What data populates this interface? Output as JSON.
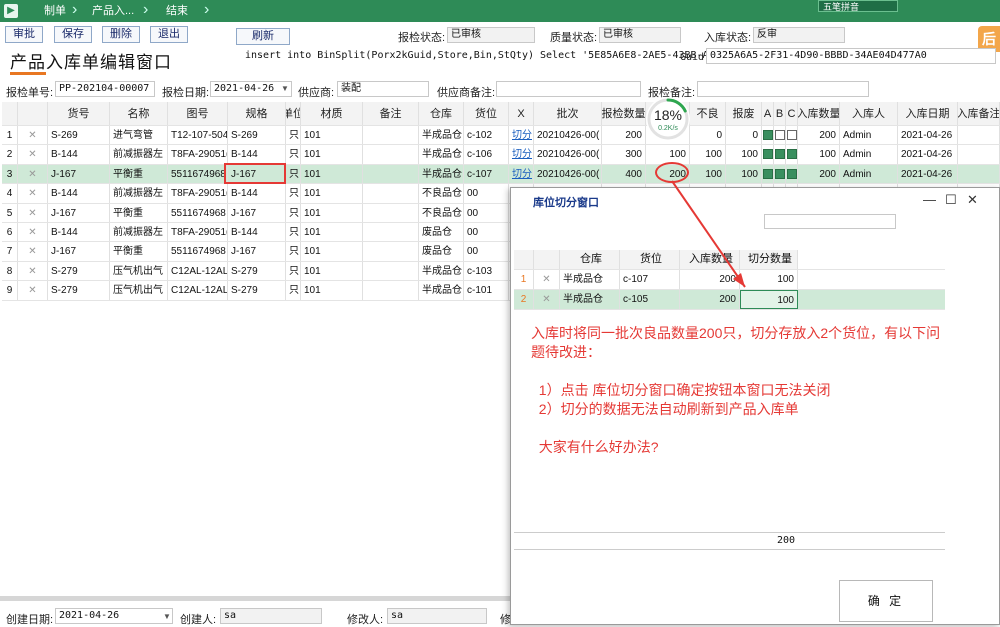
{
  "topbar": {
    "breadcrumb": [
      "制单",
      "产品入...",
      "结束"
    ],
    "ime_label": "五笔拼音"
  },
  "toolbar": {
    "buttons": [
      "审批",
      "保存",
      "删除",
      "退出"
    ],
    "refresh": "刷新",
    "inspect_status_label": "报检状态:",
    "inspect_status": "已审核",
    "quality_status_label": "质量状态:",
    "quality_status": "已审核",
    "stock_status_label": "入库状态:",
    "stock_status": "反审",
    "sql": "insert into  BinSplit(Porx2kGuid,Store,Bin,StQty)   Select '5E85A6E8-2AE5-43BB-AA8",
    "guid_label": "Guid:",
    "guid": "0325A6A5-2F31-4D90-BBBD-34AE04D477A0",
    "corner": "后"
  },
  "page_title": "产品入库单编辑窗口",
  "form": {
    "doc_no_label": "报检单号:",
    "doc_no": "PP-202104-00007",
    "date_label": "报检日期:",
    "date": "2021-04-26",
    "supplier_label": "供应商:",
    "supplier": "装配",
    "supplier_note_label": "供应商备注:",
    "inspect_note_label": "报检备注:"
  },
  "grid": {
    "headers": [
      "货号",
      "名称",
      "图号",
      "规格",
      "单位",
      "材质",
      "备注",
      "仓库",
      "货位",
      "X",
      "批次",
      "报检数量",
      "",
      "不良",
      "报废",
      "A",
      "B",
      "C",
      "入库数量",
      "入库人",
      "入库日期",
      "入库备注"
    ],
    "progress": {
      "percent": "18%",
      "speed": "0.2K/s",
      "fraction": 0.18
    },
    "rows": [
      {
        "no": "1",
        "code": "S-269",
        "name": "进气弯管",
        "drawing": "T12-107-504",
        "spec": "S-269",
        "unit": "只",
        "material": "101",
        "note": "",
        "warehouse": "半成品仓",
        "bin": "c-102",
        "split": "切分",
        "batch": "20210426-00(",
        "qty": "200",
        "good": "",
        "bad": "0",
        "scrap": "0",
        "a": true,
        "b": false,
        "c": false,
        "in_qty": "200",
        "user": "Admin",
        "in_date": "2021-04-26"
      },
      {
        "no": "2",
        "code": "B-144",
        "name": "前减振器左",
        "drawing": "T8FA-29051(",
        "spec": "B-144",
        "unit": "只",
        "material": "101",
        "note": "",
        "warehouse": "半成品仓",
        "bin": "c-106",
        "split": "切分",
        "batch": "20210426-00(",
        "qty": "300",
        "good": "100",
        "bad": "100",
        "scrap": "100",
        "a": true,
        "b": true,
        "c": true,
        "in_qty": "100",
        "user": "Admin",
        "in_date": "2021-04-26"
      },
      {
        "no": "3",
        "code": "J-167",
        "name": "平衡重",
        "drawing": "5511674968",
        "spec": "J-167",
        "unit": "只",
        "material": "101",
        "note": "",
        "warehouse": "半成品仓",
        "bin": "c-107",
        "split": "切分",
        "batch": "20210426-00(",
        "qty": "400",
        "good": "200",
        "bad": "100",
        "scrap": "100",
        "a": true,
        "b": true,
        "c": true,
        "in_qty": "200",
        "user": "Admin",
        "in_date": "2021-04-26"
      },
      {
        "no": "4",
        "code": "B-144",
        "name": "前减振器左",
        "drawing": "T8FA-29051(",
        "spec": "B-144",
        "unit": "只",
        "material": "101",
        "note": "",
        "warehouse": "不良品仓",
        "bin": "00",
        "split": "",
        "batch": "",
        "qty": "",
        "good": "",
        "bad": "",
        "scrap": "",
        "a": null,
        "b": null,
        "c": null,
        "in_qty": "",
        "user": "",
        "in_date": ""
      },
      {
        "no": "5",
        "code": "J-167",
        "name": "平衡重",
        "drawing": "5511674968",
        "spec": "J-167",
        "unit": "只",
        "material": "101",
        "note": "",
        "warehouse": "不良品仓",
        "bin": "00",
        "split": "",
        "batch": "",
        "qty": "",
        "good": "",
        "bad": "",
        "scrap": "",
        "a": null,
        "b": null,
        "c": null,
        "in_qty": "",
        "user": "",
        "in_date": ""
      },
      {
        "no": "6",
        "code": "B-144",
        "name": "前减振器左",
        "drawing": "T8FA-29051(",
        "spec": "B-144",
        "unit": "只",
        "material": "101",
        "note": "",
        "warehouse": "废品仓",
        "bin": "00",
        "split": "",
        "batch": "",
        "qty": "",
        "good": "",
        "bad": "",
        "scrap": "",
        "a": null,
        "b": null,
        "c": null,
        "in_qty": "",
        "user": "",
        "in_date": ""
      },
      {
        "no": "7",
        "code": "J-167",
        "name": "平衡重",
        "drawing": "5511674968",
        "spec": "J-167",
        "unit": "只",
        "material": "101",
        "note": "",
        "warehouse": "废品仓",
        "bin": "00",
        "split": "",
        "batch": "",
        "qty": "",
        "good": "",
        "bad": "",
        "scrap": "",
        "a": null,
        "b": null,
        "c": null,
        "in_qty": "",
        "user": "",
        "in_date": ""
      },
      {
        "no": "8",
        "code": "S-279",
        "name": "压气机出气",
        "drawing": "C12AL-12AL(",
        "spec": "S-279",
        "unit": "只",
        "material": "101",
        "note": "",
        "warehouse": "半成品仓",
        "bin": "c-103",
        "split": "",
        "batch": "",
        "qty": "",
        "good": "",
        "bad": "",
        "scrap": "",
        "a": null,
        "b": null,
        "c": null,
        "in_qty": "",
        "user": "",
        "in_date": ""
      },
      {
        "no": "9",
        "code": "S-279",
        "name": "压气机出气",
        "drawing": "C12AL-12AL(",
        "spec": "S-279",
        "unit": "只",
        "material": "101",
        "note": "",
        "warehouse": "半成品仓",
        "bin": "c-101",
        "split": "",
        "batch": "",
        "qty": "",
        "good": "",
        "bad": "",
        "scrap": "",
        "a": null,
        "b": null,
        "c": null,
        "in_qty": "",
        "user": "",
        "in_date": ""
      }
    ]
  },
  "footer": {
    "created_date_label": "创建日期:",
    "created_date": "2021-04-26",
    "creator_label": "创建人:",
    "creator": "sa",
    "modifier_label": "修改人:",
    "modifier": "sa",
    "trailing_label": "修"
  },
  "dialog": {
    "title": "库位切分窗口",
    "headers": [
      "仓库",
      "货位",
      "入库数量",
      "切分数量"
    ],
    "rows": [
      {
        "no": "1",
        "warehouse": "半成品仓",
        "bin": "c-107",
        "in_qty": "200",
        "split_qty": "100"
      },
      {
        "no": "2",
        "warehouse": "半成品仓",
        "bin": "c-105",
        "in_qty": "200",
        "split_qty": "100"
      }
    ],
    "total": "200",
    "ok": "确 定",
    "note_lines": [
      "入库时将同一批次良品数量200只，切分存放入2个货位，有以下问",
      "题待改进：",
      "",
      "  1）点击 库位切分窗口确定按钮本窗口无法关闭",
      "  2）切分的数据无法自动刷新到产品入库单",
      "",
      "  大家有什么好办法?"
    ]
  },
  "colors": {
    "accent": "#2e8b57",
    "highlight": "#e53935",
    "selected_row": "#cfe9d7",
    "title_underline": "#e87722"
  }
}
